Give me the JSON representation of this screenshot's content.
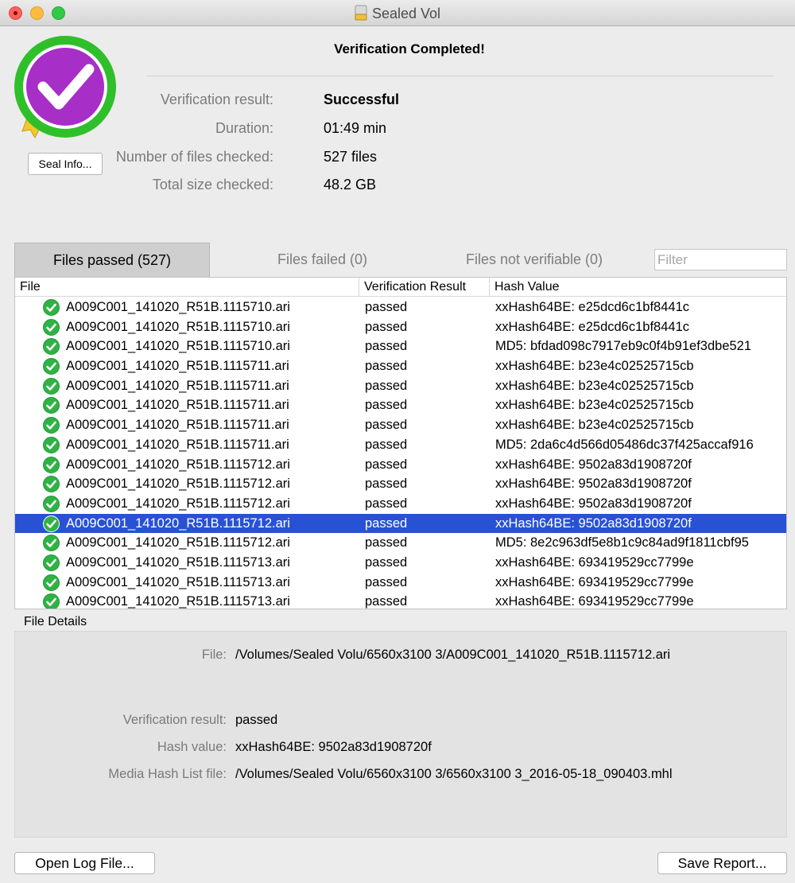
{
  "window": {
    "title": "Sealed Vol",
    "icon": "drive-icon"
  },
  "seal": {
    "icon": "seal-checkmark-icon",
    "colors": {
      "ring": "#2fbf2a",
      "disc": "#a82ec8",
      "ribbon": "#f1c92a"
    },
    "info_button": "Seal Info..."
  },
  "heading": "Verification Completed!",
  "summary": [
    {
      "label": "Verification result:",
      "value": "Successful",
      "bold": true
    },
    {
      "label": "Duration:",
      "value": "01:49 min"
    },
    {
      "label": "Number of files checked:",
      "value": "527 files"
    },
    {
      "label": "Total size checked:",
      "value": "48.2 GB"
    }
  ],
  "tabs": [
    {
      "label": "Files passed (527)",
      "active": true
    },
    {
      "label": "Files failed (0)"
    },
    {
      "label": "Files not verifiable (0)"
    }
  ],
  "filter": {
    "placeholder": "Filter",
    "value": ""
  },
  "table": {
    "columns": [
      "File",
      "Verification Result",
      "Hash Value"
    ],
    "rows": [
      {
        "file": "A009C001_141020_R51B.1115710.ari",
        "result": "passed",
        "hash": "xxHash64BE: e25dcd6c1bf8441c"
      },
      {
        "file": "A009C001_141020_R51B.1115710.ari",
        "result": "passed",
        "hash": "xxHash64BE: e25dcd6c1bf8441c"
      },
      {
        "file": "A009C001_141020_R51B.1115710.ari",
        "result": "passed",
        "hash": "MD5: bfdad098c7917eb9c0f4b91ef3dbe521"
      },
      {
        "file": "A009C001_141020_R51B.1115711.ari",
        "result": "passed",
        "hash": "xxHash64BE: b23e4c02525715cb"
      },
      {
        "file": "A009C001_141020_R51B.1115711.ari",
        "result": "passed",
        "hash": "xxHash64BE: b23e4c02525715cb"
      },
      {
        "file": "A009C001_141020_R51B.1115711.ari",
        "result": "passed",
        "hash": "xxHash64BE: b23e4c02525715cb"
      },
      {
        "file": "A009C001_141020_R51B.1115711.ari",
        "result": "passed",
        "hash": "xxHash64BE: b23e4c02525715cb"
      },
      {
        "file": "A009C001_141020_R51B.1115711.ari",
        "result": "passed",
        "hash": "MD5: 2da6c4d566d05486dc37f425accaf916"
      },
      {
        "file": "A009C001_141020_R51B.1115712.ari",
        "result": "passed",
        "hash": "xxHash64BE: 9502a83d1908720f"
      },
      {
        "file": "A009C001_141020_R51B.1115712.ari",
        "result": "passed",
        "hash": "xxHash64BE: 9502a83d1908720f"
      },
      {
        "file": "A009C001_141020_R51B.1115712.ari",
        "result": "passed",
        "hash": "xxHash64BE: 9502a83d1908720f"
      },
      {
        "file": "A009C001_141020_R51B.1115712.ari",
        "result": "passed",
        "hash": "xxHash64BE: 9502a83d1908720f",
        "selected": true
      },
      {
        "file": "A009C001_141020_R51B.1115712.ari",
        "result": "passed",
        "hash": "MD5: 8e2c963df5e8b1c9c84ad9f1811cbf95"
      },
      {
        "file": "A009C001_141020_R51B.1115713.ari",
        "result": "passed",
        "hash": "xxHash64BE: 693419529cc7799e"
      },
      {
        "file": "A009C001_141020_R51B.1115713.ari",
        "result": "passed",
        "hash": "xxHash64BE: 693419529cc7799e"
      },
      {
        "file": "A009C001_141020_R51B.1115713.ari",
        "result": "passed",
        "hash": "xxHash64BE: 693419529cc7799e"
      }
    ],
    "row_icon": "passed-check-icon",
    "selected_color": "#2852d4"
  },
  "details": {
    "title": "File Details",
    "file_label": "File:",
    "file_value": "/Volumes/Sealed Volu/6560x3100 3/A009C001_141020_R51B.1115712.ari",
    "result_label": "Verification result:",
    "result_value": "passed",
    "hash_label": "Hash value:",
    "hash_value": "xxHash64BE: 9502a83d1908720f",
    "mhl_label": "Media Hash List file:",
    "mhl_value": "/Volumes/Sealed Volu/6560x3100 3/6560x3100 3_2016-05-18_090403.mhl"
  },
  "buttons": {
    "open_log": "Open Log File...",
    "save_report": "Save Report..."
  }
}
